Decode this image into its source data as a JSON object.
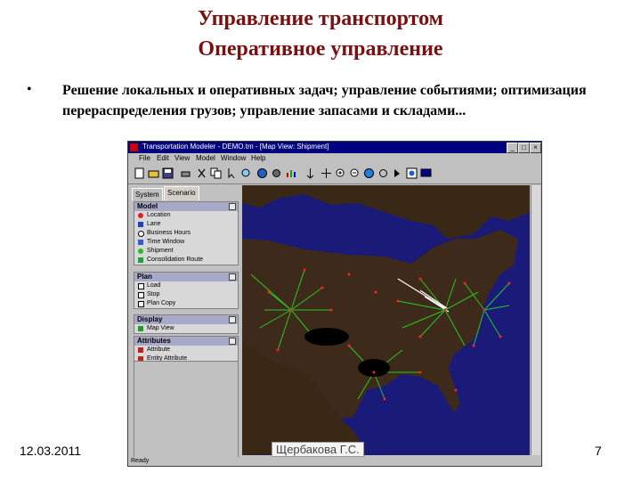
{
  "slide": {
    "title_line1": "Управление транспортом",
    "title_line2": "Оперативное управление",
    "bullet_symbol": "•",
    "bullet_text": "Решение локальных и оперативных задач; управление событиями; оптимизация перераспределения грузов; управление запасами и складами...",
    "date": "12.03.2011",
    "author": "Щербакова Г.С.",
    "page_number": "7",
    "title_color": "#7a1010"
  },
  "app_window": {
    "title": "Transportation Modeler - DEMO.tm - [Map View: Shipment]",
    "menu": [
      "File",
      "Edit",
      "View",
      "Model",
      "Window",
      "Help"
    ],
    "tabs": [
      "System",
      "Scenario"
    ],
    "active_tab": "Scenario",
    "sections": [
      {
        "header": "Model",
        "items": [
          {
            "label": "Location",
            "icon": "red-dot-icon"
          },
          {
            "label": "Lane",
            "icon": "lane-icon"
          },
          {
            "label": "Business Hours",
            "icon": "clock-icon"
          },
          {
            "label": "Time Window",
            "icon": "window-icon"
          },
          {
            "label": "Shipment",
            "icon": "green-dot-icon"
          },
          {
            "label": "Consolidation Route",
            "icon": "route-icon"
          }
        ]
      },
      {
        "header": "Plan",
        "items": [
          {
            "label": "Load",
            "icon": "load-icon"
          },
          {
            "label": "Stop",
            "icon": "stop-icon"
          },
          {
            "label": "Plan Copy",
            "icon": "copy-icon"
          }
        ]
      },
      {
        "header": "Display",
        "items": [
          {
            "label": "Map View",
            "icon": "map-icon"
          }
        ]
      },
      {
        "header": "Attributes",
        "items": [
          {
            "label": "Attribute",
            "icon": "attribute-icon"
          },
          {
            "label": "Entity Attribute",
            "icon": "entity-attribute-icon"
          }
        ]
      }
    ],
    "status_text": "Ready",
    "colors": {
      "titlebar": "#000080",
      "map_water": "#1a1a78",
      "map_land": "#3d2a1a",
      "route_green": "#22dd22",
      "location_red": "#ff2020"
    }
  }
}
